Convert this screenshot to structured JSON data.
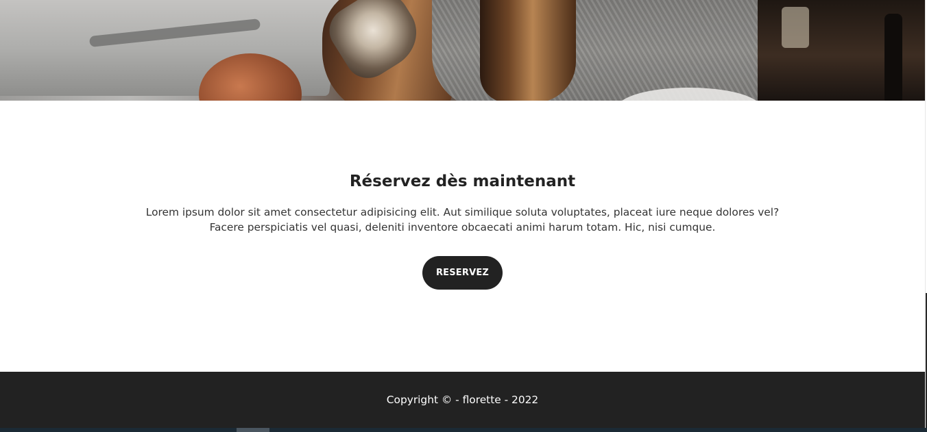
{
  "hero": {
    "image_alt": "woman-with-glass-photo"
  },
  "cta": {
    "title": "Réservez dès maintenant",
    "text": "Lorem ipsum dolor sit amet consectetur adipisicing elit. Aut similique soluta voluptates, placeat iure neque dolores vel? Facere perspiciatis vel quasi, deleniti inventore obcaecati animi harum totam. Hic, nisi cumque.",
    "button_label": "RESERVEZ"
  },
  "footer": {
    "copyright": "Copyright © - florette - 2022"
  },
  "colors": {
    "dark": "#222222",
    "text": "#333333",
    "background": "#ffffff",
    "taskbar": "#1b2a35"
  }
}
